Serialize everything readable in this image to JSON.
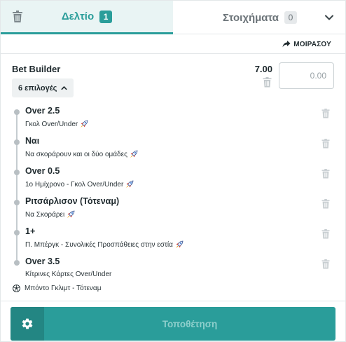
{
  "tabs": {
    "slip_label": "Δελτίο",
    "slip_count": "1",
    "bets_label": "Στοιχήματα",
    "bets_count": "0"
  },
  "share": {
    "label": "ΜΟΙΡΑΣΟΥ"
  },
  "bet_builder": {
    "title": "Bet Builder",
    "odds": "7.00",
    "stake_placeholder": "0.00",
    "selections_toggle": "6 επιλογές"
  },
  "selections": [
    {
      "market": "Over 2.5",
      "desc": "Γκολ Over/Under",
      "boosted": true
    },
    {
      "market": "Ναι",
      "desc": "Να σκοράρουν και οι δύο ομάδες",
      "boosted": true
    },
    {
      "market": "Over 0.5",
      "desc": "1ο Ημίχρονο - Γκολ Over/Under",
      "boosted": true
    },
    {
      "market": "Ριτσάρλισον (Τότεναμ)",
      "desc": "Να Σκοράρει",
      "boosted": true
    },
    {
      "market": "1+",
      "desc": "Π. Μπέργκ - Συνολικές Προσπάθειες στην εστία",
      "boosted": true
    },
    {
      "market": "Over 3.5",
      "desc": "Κίτρινες Κάρτες Over/Under",
      "boosted": false
    }
  ],
  "event": {
    "name": "Μπόντο Γκλιμτ - Τότεναμ",
    "icon": "soccer-ball-icon"
  },
  "place_bet": {
    "label": "Τοποθέτηση"
  },
  "colors": {
    "accent": "#2a9d9a",
    "accent_dark": "#238683",
    "active_tab_bg": "#e9f4f4",
    "place_label": "#8ecfcc"
  }
}
